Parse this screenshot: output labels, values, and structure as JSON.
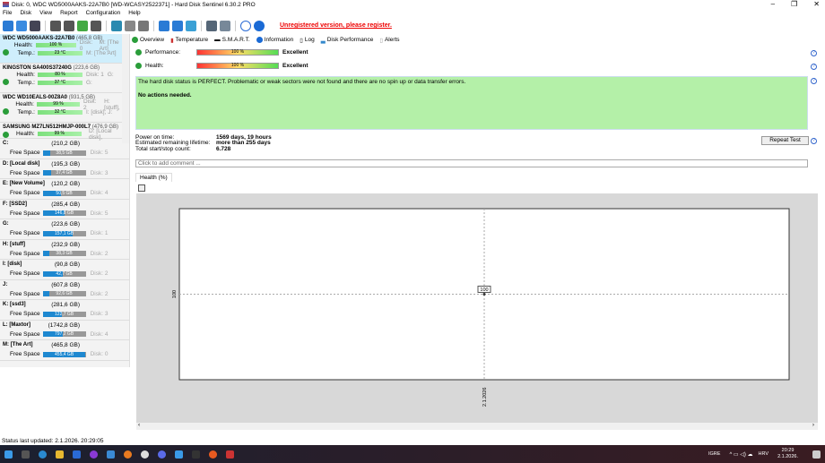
{
  "window": {
    "title": "Disk: 0, WDC WD5000AAKS-22A7B0 [WD-WCASY2522371]  -  Hard Disk Sentinel 6.30.2 PRO"
  },
  "menu": [
    "File",
    "Disk",
    "View",
    "Report",
    "Configuration",
    "Help"
  ],
  "toolbar": {
    "unregistered": "Unregistered version, please register."
  },
  "disks": [
    {
      "name": "WDC WD5000AAKS-22A7B0",
      "size": "(465,8 GB)",
      "health": "100 %",
      "health_pct": 100,
      "temp": "23 °C",
      "disk": "Disk: 0",
      "letters": "M: [The Art]",
      "selected": true
    },
    {
      "name": "KINGSTON SA400S37240G",
      "size": "(223,6 GB)",
      "health": "80 %",
      "health_pct": 80,
      "temp": "37 °C",
      "disk": "Disk: 1",
      "letters": "G:"
    },
    {
      "name": "WDC WD10EALS-00Z8A0",
      "size": "(931,5 GB)",
      "health": "99 %",
      "health_pct": 99,
      "temp": "32 °C",
      "disk": "Disk: 2",
      "letters": "H: [stuff],",
      "letters2": "I: [disk], J:"
    },
    {
      "name": "SAMSUNG MZ7LN512HMJP-000L7",
      "size": "(476,9 GB)",
      "health": "99 %",
      "health_pct": 99,
      "disk": "",
      "letters": "D: [Local disk],"
    }
  ],
  "labels": {
    "health": "Health:",
    "temp": "Temp.:",
    "free_space": "Free Space"
  },
  "drives": [
    {
      "name": "C:",
      "size": "(210,2 GB)",
      "free": "38,5 GB",
      "pct": 18,
      "disk": "Disk: 5"
    },
    {
      "name": "D: [Local disk]",
      "size": "(195,3 GB)",
      "free": "37,4 GB",
      "pct": 19,
      "disk": "Disk: 3"
    },
    {
      "name": "E: [New Volume]",
      "size": "(120,2 GB)",
      "free": "50,5 GB",
      "pct": 42,
      "disk": "Disk: 4"
    },
    {
      "name": "F: [SSD2]",
      "size": "(285,4 GB)",
      "free": "146,8 GB",
      "pct": 51,
      "disk": "Disk: 5"
    },
    {
      "name": "G:",
      "size": "(223,6 GB)",
      "free": "157,1 GB",
      "pct": 70,
      "disk": "Disk: 1"
    },
    {
      "name": "H: [stuff]",
      "size": "(232,9 GB)",
      "free": "38,3 GB",
      "pct": 16,
      "disk": "Disk: 2"
    },
    {
      "name": "I: [disk]",
      "size": "(90,8 GB)",
      "free": "42,7 GB",
      "pct": 47,
      "disk": "Disk: 2"
    },
    {
      "name": "J:",
      "size": "(607,8 GB)",
      "free": "92,6 GB",
      "pct": 15,
      "disk": "Disk: 2"
    },
    {
      "name": "K: [ssd3]",
      "size": "(281,6 GB)",
      "free": "122,7 GB",
      "pct": 44,
      "disk": "Disk: 3"
    },
    {
      "name": "L: [Maxtor]",
      "size": "(1742,8 GB)",
      "free": "797,2 GB",
      "pct": 46,
      "disk": "Disk: 4"
    },
    {
      "name": "M: [The Art]",
      "size": "(465,8 GB)",
      "free": "455,4 GB",
      "pct": 98,
      "disk": "Disk: 0"
    }
  ],
  "tabs": [
    "Overview",
    "Temperature",
    "S.M.A.R.T.",
    "Information",
    "Log",
    "Disk Performance",
    "Alerts"
  ],
  "overview": {
    "performance_label": "Performance:",
    "performance": "100 %",
    "performance_pct": 100,
    "performance_text": "Excellent",
    "health_label": "Health:",
    "health": "100 %",
    "health_pct": 100,
    "health_text": "Excellent",
    "status": "The hard disk status is PERFECT. Problematic or weak sectors were not found and there are no spin up or data transfer errors.",
    "actions": "No actions needed.",
    "power_on_label": "Power on time:",
    "power_on": "1569 days, 19 hours",
    "lifetime_label": "Estimated remaining lifetime:",
    "lifetime": "more than 255 days",
    "startstop_label": "Total start/stop count:",
    "startstop": "6.728",
    "repeat_test": "Repeat Test",
    "comment_placeholder": "Click to add comment ...",
    "chart_tab": "Health (%)"
  },
  "chart_data": {
    "type": "line",
    "x": [
      "2.1.2026"
    ],
    "values": [
      100
    ],
    "ylabel": "",
    "xlabel": "",
    "yticks": [
      "100"
    ],
    "data_labels": [
      "100"
    ]
  },
  "statusbar": "Status last updated: 2.1.2026. 20:29:05",
  "taskbar": {
    "lang_game": "IGRE",
    "lang": "HRV",
    "time": "20:29",
    "date": "2.1.2026."
  }
}
